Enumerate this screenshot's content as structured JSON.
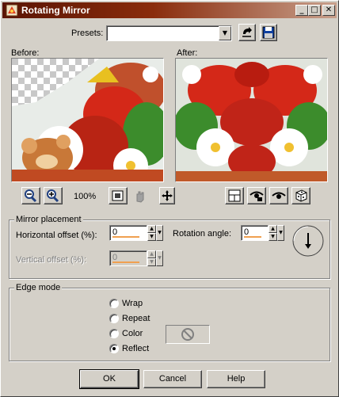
{
  "window": {
    "title": "Rotating Mirror",
    "titlebar_buttons": {
      "minimize": "_",
      "maximize": "□",
      "close": "✕"
    }
  },
  "presets": {
    "label": "Presets:",
    "value": "",
    "load_icon": "refresh-arrow-icon",
    "save_icon": "floppy-disk-icon"
  },
  "previews": {
    "before_label": "Before:",
    "after_label": "After:"
  },
  "preview_toolbar": {
    "zoom_level": "100%",
    "zoom_out_icon": "zoom-out-icon",
    "zoom_in_icon": "zoom-in-icon",
    "zoom_fit_icon": "zoom-fit-icon",
    "pan_icon": "hand-icon",
    "move_icon": "move-cross-icon",
    "after_icons": [
      "preview-window-icon",
      "camera-eye-icon",
      "eye-icon",
      "dice-randomize-icon"
    ]
  },
  "mirror_placement": {
    "title": "Mirror placement",
    "horizontal_label": "Horizontal offset (%):",
    "horizontal_value": "0",
    "vertical_label": "Vertical offset (%):",
    "vertical_value": "0",
    "vertical_enabled": false,
    "rotation_label": "Rotation angle:",
    "rotation_value": "0",
    "dial_icon": "angle-dial-icon"
  },
  "edge_mode": {
    "title": "Edge mode",
    "options": [
      {
        "label": "Wrap",
        "checked": false
      },
      {
        "label": "Repeat",
        "checked": false
      },
      {
        "label": "Color",
        "checked": false
      },
      {
        "label": "Reflect",
        "checked": true
      }
    ],
    "color_swatch_icon": "no-color-icon"
  },
  "buttons": {
    "ok": "OK",
    "cancel": "Cancel",
    "help": "Help"
  },
  "colors": {
    "titlebar_start": "#5a1404",
    "titlebar_end": "#c8a08c",
    "face": "#d4d0c8",
    "slider_accent": "#f0a050"
  }
}
